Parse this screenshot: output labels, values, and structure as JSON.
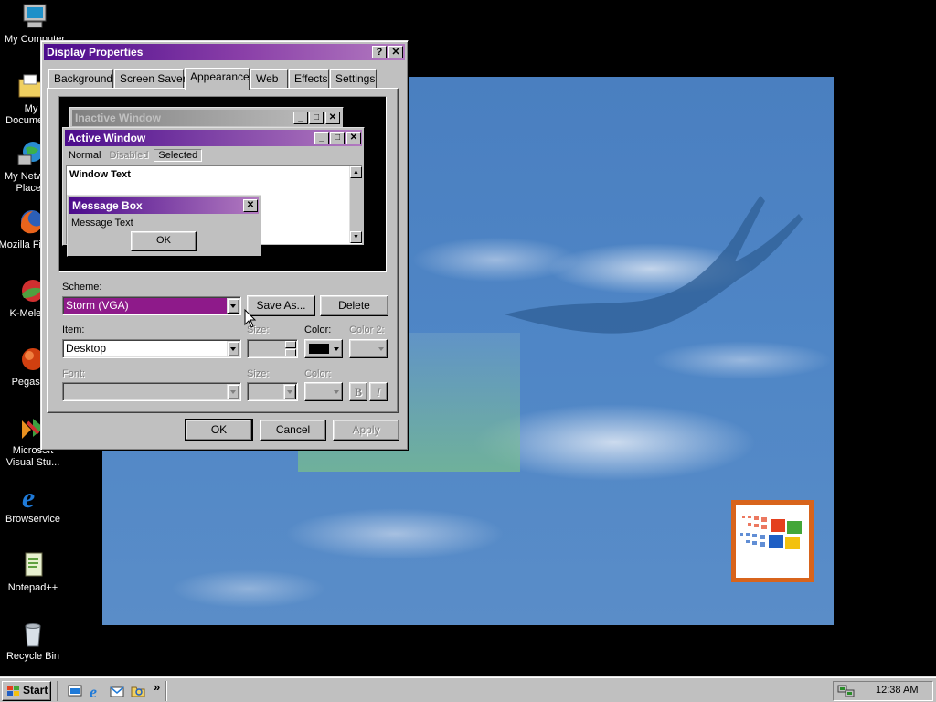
{
  "desktop": {
    "icons": [
      {
        "label": "My Computer"
      },
      {
        "label": "My Documents"
      },
      {
        "label": "My Network\nPlaces"
      },
      {
        "label": "Mozilla Firefox"
      },
      {
        "label": "K-Meleon"
      },
      {
        "label": "Pegasus"
      },
      {
        "label": "Microsoft\nVisual Stu..."
      },
      {
        "label": "Browservice"
      },
      {
        "label": "Notepad++"
      },
      {
        "label": "Recycle Bin"
      }
    ]
  },
  "dialog": {
    "title": "Display Properties",
    "help_glyph": "?",
    "close_glyph": "✕",
    "tabs": [
      {
        "label": "Background"
      },
      {
        "label": "Screen Saver"
      },
      {
        "label": "Appearance"
      },
      {
        "label": "Web"
      },
      {
        "label": "Effects"
      },
      {
        "label": "Settings"
      }
    ],
    "active_tab": "Appearance",
    "preview": {
      "inactive_title": "Inactive Window",
      "active_title": "Active Window",
      "menu_normal": "Normal",
      "menu_disabled": "Disabled",
      "menu_selected": "Selected",
      "window_text": "Window Text",
      "msgbox_title": "Message Box",
      "msgbox_text": "Message Text",
      "msgbox_ok": "OK"
    },
    "scheme_label": "Scheme:",
    "scheme_value": "Storm (VGA)",
    "save_as": "Save As...",
    "delete": "Delete",
    "item_label": "Item:",
    "item_value": "Desktop",
    "size_label": "Size:",
    "color_label": "Color:",
    "color2_label": "Color 2:",
    "font_label": "Font:",
    "font_size_label": "Size:",
    "font_color_label": "Color:",
    "bold_glyph": "B",
    "italic_glyph": "I",
    "ok": "OK",
    "cancel": "Cancel",
    "apply": "Apply"
  },
  "colors": {
    "title_active_start": "#4b0b8c",
    "title_active_end": "#b27ac0",
    "scheme_highlight": "#8e1a8a",
    "selected_color_swatch": "#000000"
  },
  "taskbar": {
    "start": "Start",
    "chevron": "»",
    "clock": "12:38 AM"
  }
}
